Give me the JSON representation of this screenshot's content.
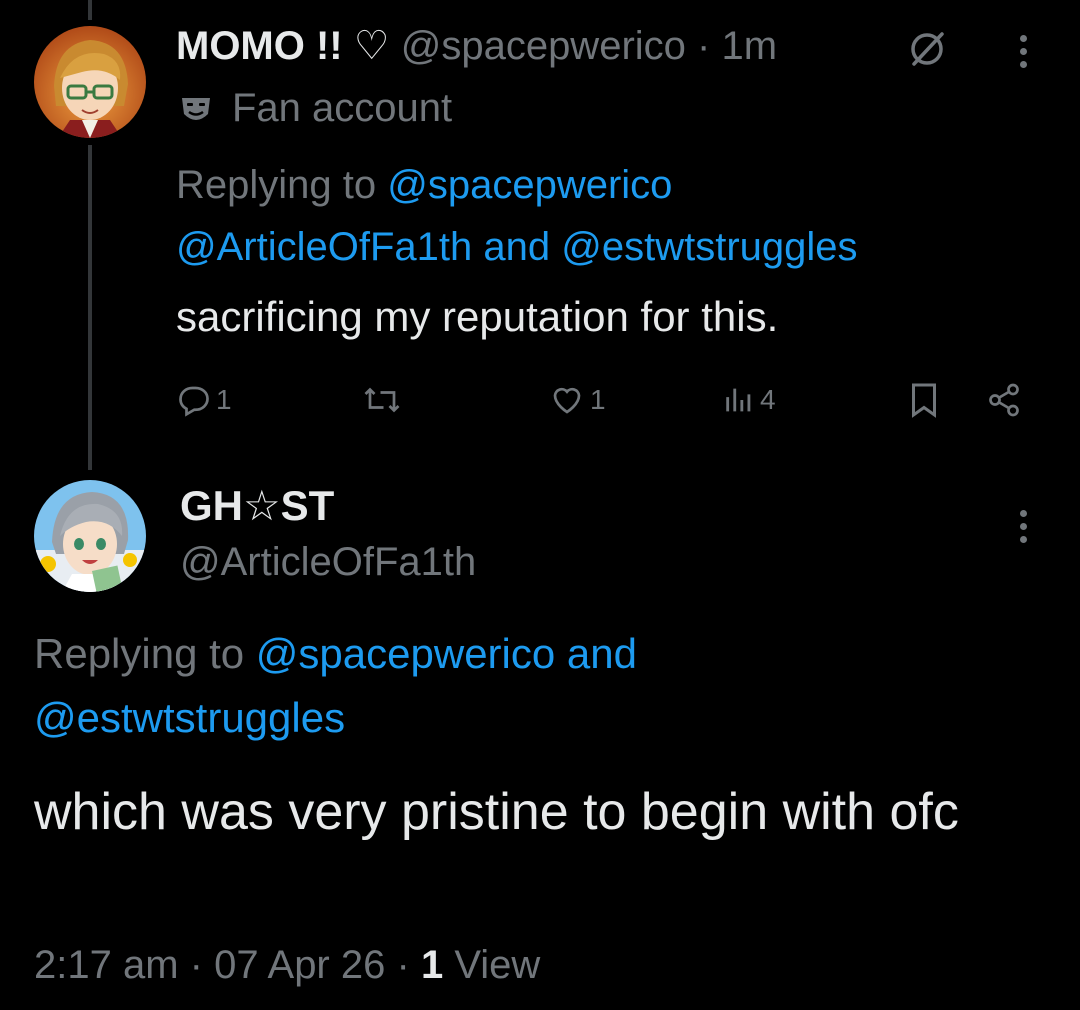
{
  "reply_tweet": {
    "display_name": "MOMO !! ♡",
    "handle": "@spacepwerico",
    "separator": "·",
    "time_ago": "1m",
    "fan_label": "Fan account",
    "replying_prefix": "Replying to",
    "replying_to_1": "@spacepwerico",
    "replying_to_2": "@ArticleOfFa1th",
    "replying_and": "and",
    "replying_to_3": "@estwtstruggles",
    "text": "sacrificing my reputation for this.",
    "reply_count": "1",
    "like_count": "1",
    "view_count": "4"
  },
  "main_tweet": {
    "display_name": "GH☆ST",
    "handle": "@ArticleOfFa1th",
    "replying_prefix": "Replying to",
    "replying_to_1": "@spacepwerico",
    "replying_and": "and",
    "replying_to_2": "@estwtstruggles",
    "text": "which was very pristine to begin with ofc",
    "time": "2:17 am",
    "date": "07 Apr 26",
    "separator": "·",
    "views_count": "1",
    "views_label": "View"
  },
  "icons": [
    "theater-masks-icon",
    "circle-slash-icon",
    "more-vertical-icon",
    "reply-icon",
    "retweet-icon",
    "like-icon",
    "views-icon",
    "bookmark-icon",
    "share-icon"
  ],
  "colors": {
    "background": "#000000",
    "text": "#e7e9ea",
    "muted": "#71767b",
    "link": "#1d9bf0"
  }
}
